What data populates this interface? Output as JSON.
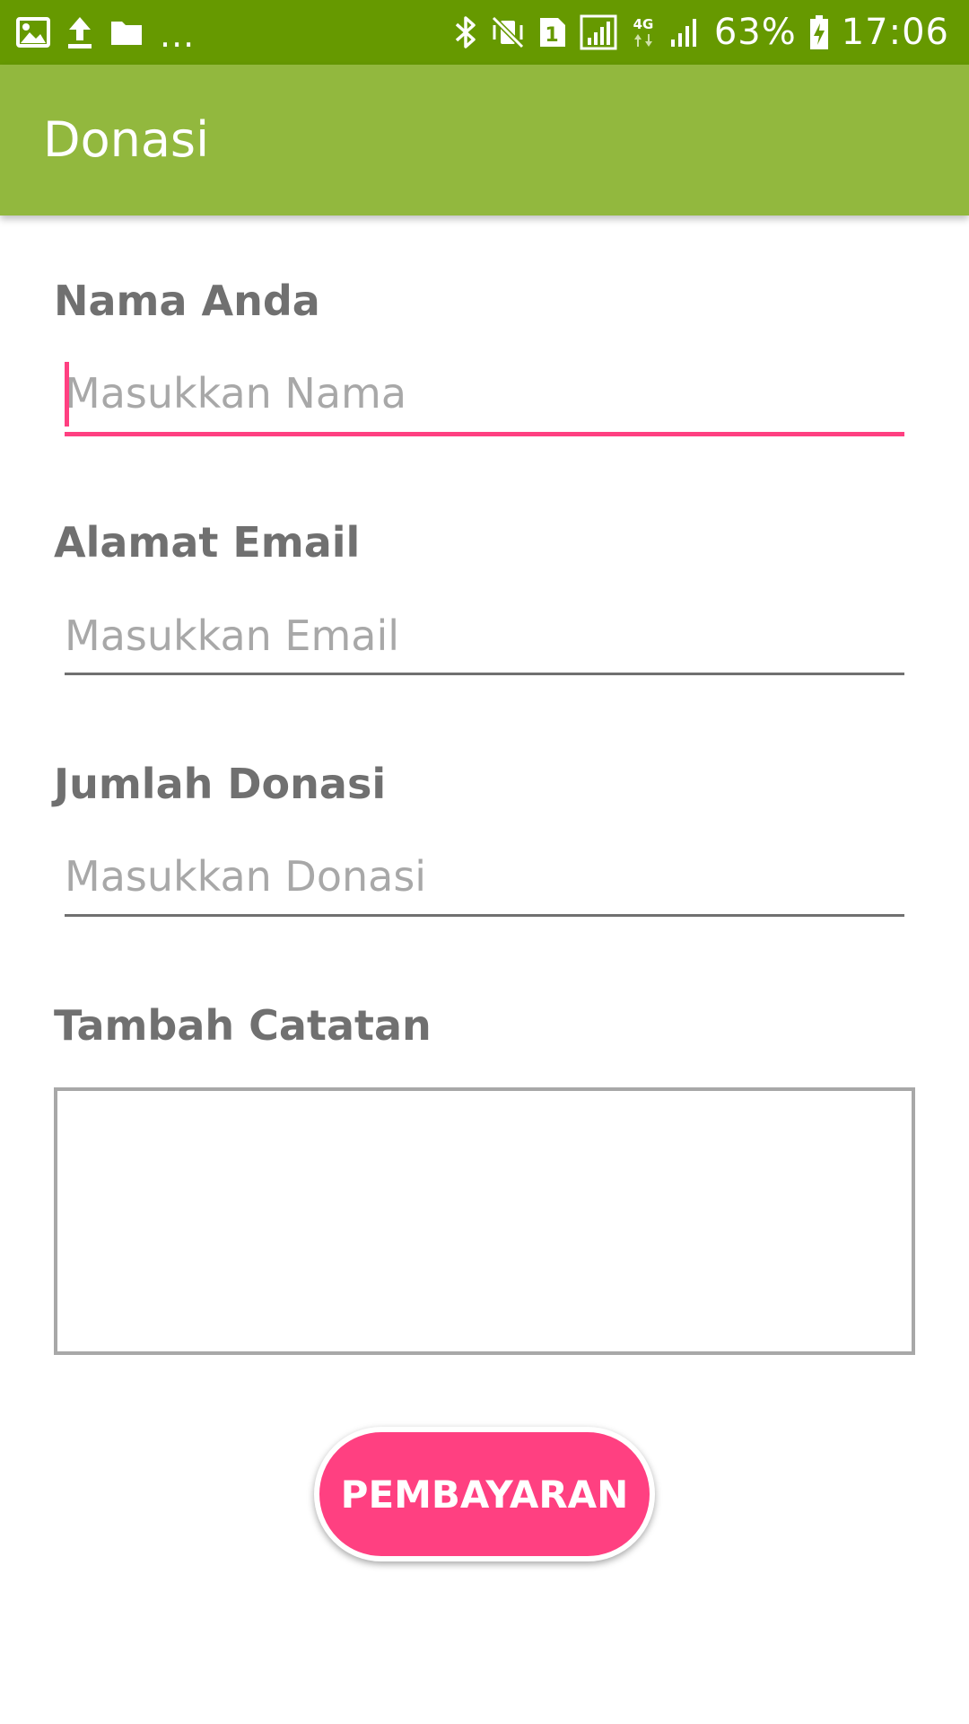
{
  "status_bar": {
    "left_icons": [
      "image-icon",
      "upload-icon",
      "folder-icon",
      "more-notifications-icon"
    ],
    "more_text": "...",
    "right_icons": [
      "bluetooth-icon",
      "vibrate-mute-icon",
      "sim1-icon",
      "signal-icon",
      "4g-icon",
      "signal-bars-icon",
      "battery-charging-icon"
    ],
    "network_type": "4G",
    "sim_label": "1",
    "battery_percent": "63%",
    "time": "17:06",
    "background_color": "#669900"
  },
  "app_bar": {
    "title": "Donasi",
    "background_color": "#92b83e"
  },
  "form": {
    "name": {
      "label": "Nama Anda",
      "placeholder": "Masukkan Nama",
      "value": "",
      "focused": true
    },
    "email": {
      "label": "Alamat Email",
      "placeholder": "Masukkan Email",
      "value": ""
    },
    "amount": {
      "label": "Jumlah Donasi",
      "placeholder": "Masukkan Donasi",
      "value": ""
    },
    "notes": {
      "label": "Tambah Catatan",
      "value": ""
    },
    "submit_label": "PEMBAYARAN",
    "accent_color": "#ff4081"
  }
}
